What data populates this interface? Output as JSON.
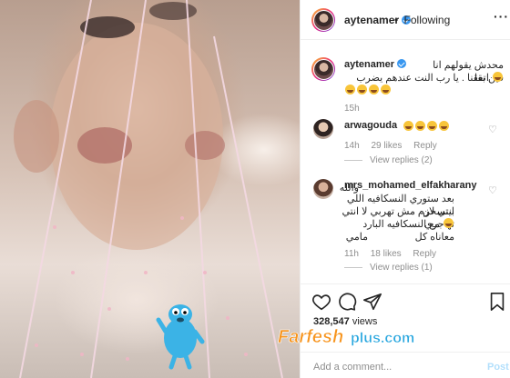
{
  "post": {
    "author": "aytenamer",
    "follow_label": "Following",
    "separator": "•",
    "views_count": "328,547",
    "views_label": "views",
    "add_comment_placeholder": "Add a comment...",
    "post_label": "Post"
  },
  "caption": {
    "username": "aytenamer",
    "text_line1": "محدش يقولهم انا فين بقا",
    "text_line2": "اتفقنا . يا رب النت عندهم يضرب",
    "emoji_count_line1": 1,
    "emoji_count_line2": 4,
    "age": "15h"
  },
  "comments": [
    {
      "username": "arwagouda",
      "emoji_count": 4,
      "age": "14h",
      "likes": "29 likes",
      "reply_label": "Reply",
      "view_replies": "View replies (2)"
    },
    {
      "username": "mrs_mohamed_elfakharany",
      "lines": [
        "والله",
        "بعد ستوري النسكافيه اللي بيتسخن",
        "انتي لازم مش تهربي لا انتي تهاجري",
        "مع النسكافيه البارد معاناه كل",
        "مامي"
      ],
      "sad_emoji_line": 3,
      "age": "11h",
      "likes": "18 likes",
      "reply_label": "Reply",
      "view_replies": "View replies (1)"
    }
  ],
  "icons": {
    "more": "more-options-icon",
    "like": "heart-icon",
    "comment": "comment-bubble-icon",
    "share": "paper-plane-icon",
    "save": "bookmark-icon",
    "comment_like": "heart-outline-icon"
  },
  "watermark": {
    "text_main": "Farfesh",
    "text_suffix": "plus.com"
  },
  "colors": {
    "text": "#262626",
    "muted": "#8e8e8e",
    "verified": "#3897f0",
    "post_disabled": "#b2dffc",
    "watermark_orange": "#f7941d",
    "watermark_blue": "#2aa7df"
  }
}
